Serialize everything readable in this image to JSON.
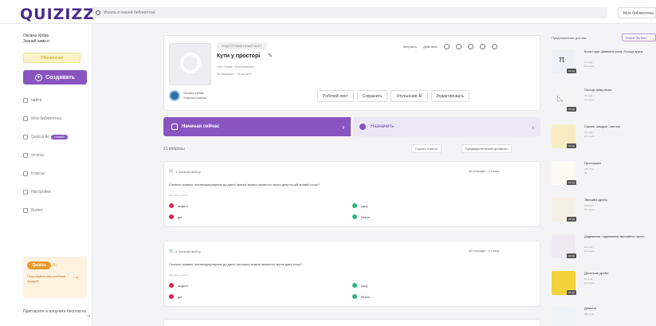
{
  "topbar": {
    "logo": "QUIZIZZ",
    "search_placeholder": "Искать в нашей библиотеке",
    "library_label": "Моя библиотека"
  },
  "sidebar": {
    "user_name": "Оксана Урбаs",
    "user_role": "Зазнай азмісл",
    "upgrade_label": "Обновление",
    "create_label": "Создавать",
    "nav_items": [
      {
        "label": "найти",
        "icon": "search-icon"
      },
      {
        "label": "Моя библиотека",
        "icon": "library-icon"
      },
      {
        "label": "Quizizz AI",
        "icon": "ai-icon",
        "badge": "Новый"
      },
      {
        "label": "отчеты",
        "icon": "reports-icon"
      },
      {
        "label": "Классы",
        "icon": "classes-icon"
      },
      {
        "label": "Настройки",
        "icon": "settings-icon"
      },
      {
        "label": "Более",
        "icon": "more-icon"
      }
    ],
    "promo_logo": "Quizizz",
    "promo_sub": "AI",
    "promo_text": "Попробуйте наш учебный продукт",
    "bottom_link": "Пригласите и получите бесплатно"
  },
  "quiz": {
    "tag": "ПОДГОТОВЛЕННЫЙ ВИКТ",
    "title": "Кути у просторі",
    "meta1": "11th Grade · Математика",
    "meta2": "2К показать · 31 играть",
    "author_name": "Оксана Урбаs",
    "author_sub": "Учитель класса",
    "top_actions": [
      "Встроить",
      "Действия"
    ],
    "actions": [
      "Рабочий лист",
      "Сохранить",
      "Улучшение AI",
      "Редактировать"
    ]
  },
  "start_label": "Начиная сейчас",
  "assign_label": "Назначить",
  "question_count": "21 вопросы",
  "hide_answers": "Скрыть ответы",
  "preview_label": "Предварительный просмотр",
  "questions": [
    {
      "type": "1. Больше выбор",
      "time": "45 секунды · 1 точка",
      "text": "Сколько прямих, перпендикулярних до даної прямої можна провести через дану на цій прямій точку?",
      "answers_label": "Варианты ответа",
      "answers": [
        "жодної",
        "одну",
        "дві",
        "безліч"
      ]
    },
    {
      "type": "2. Больше выбор",
      "time": "45 секунды · 1 точка",
      "text": "Сколько прямих, перпендикулярних до даної площини можна провести через дану точку?",
      "answers_label": "Варианты ответа",
      "answers": [
        "жодної",
        "одну",
        "дві",
        "безліч"
      ]
    }
  ],
  "right": {
    "head": "Предложенные для вас",
    "button": "Новое ЗА ВАС",
    "recs": [
      {
        "title": "Кола і круг. Довжина кола. Площа круга",
        "meta1": "31 игра",
        "meta2": "5К играть",
        "count": "12 Qs"
      },
      {
        "title": "Площа трикутника",
        "meta1": "32 игра",
        "meta2": "4К играть",
        "count": "15 Qs"
      },
      {
        "title": "Самые, каждые, частью",
        "meta1": "43 игра",
        "meta2": "2К играть",
        "count": "10 Qs"
      },
      {
        "title": "Пропорции",
        "meta1": "185 игра",
        "meta2": "3К",
        "count": "14 Qs"
      },
      {
        "title": "Звичайні дроби",
        "meta1": "113 игра",
        "meta2": "3К играть",
        "count": "18 Qs"
      },
      {
        "title": "Додавання і віднімання звичайних чисел",
        "meta1": "23 игра",
        "meta2": "2К играть",
        "count": "16 Qs"
      },
      {
        "title": "Десяткові дроби",
        "meta1": "59 игра",
        "meta2": "2К играть",
        "count": "15 Qs"
      },
      {
        "title": "Ділення",
        "meta1": "188 игра",
        "meta2": "",
        "count": "12 Qs"
      }
    ]
  }
}
